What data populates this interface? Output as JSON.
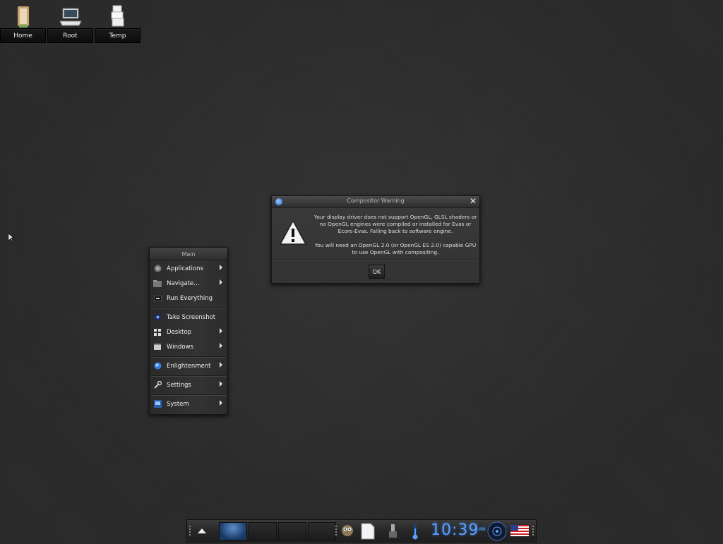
{
  "desktop": {
    "shortcuts": [
      {
        "label": "Home",
        "icon": "home-door-icon"
      },
      {
        "label": "Root",
        "icon": "computer-laptop-icon"
      },
      {
        "label": "Temp",
        "icon": "temp-folder-icon"
      }
    ]
  },
  "dialog": {
    "title": "Compositor Warning",
    "icon": "warning-triangle-icon",
    "message_1": "Your display driver does not support OpenGL, GLSL shaders or no OpenGL engines were compiled or installed for Evas or Ecore-Evas. Falling back to software engine.",
    "message_2": "You will need an OpenGL 2.0 (or OpenGL ES 2.0) capable GPU to use OpenGL with compositing.",
    "ok_label": "OK",
    "close_glyph": "✕"
  },
  "menu": {
    "title": "Main",
    "items": [
      {
        "label": "Applications",
        "icon": "applications-icon",
        "submenu": true
      },
      {
        "label": "Navigate...",
        "icon": "navigate-folder-icon",
        "submenu": true
      },
      {
        "label": "Run Everything",
        "icon": "run-everything-icon",
        "submenu": false
      },
      {
        "label": "Take Screenshot",
        "icon": "screenshot-icon",
        "submenu": false
      },
      {
        "label": "Desktop",
        "icon": "desktop-grid-icon",
        "submenu": true
      },
      {
        "label": "Windows",
        "icon": "windows-icon",
        "submenu": true
      },
      {
        "label": "Enlightenment",
        "icon": "enlightenment-logo-icon",
        "submenu": true
      },
      {
        "label": "Settings",
        "icon": "settings-wrench-icon",
        "submenu": true
      },
      {
        "label": "System",
        "icon": "system-icon",
        "submenu": true
      }
    ]
  },
  "shelf": {
    "pager_desktops": 4,
    "active_desktop": 1,
    "clock_time": "10:39",
    "clock_ampm": "AM",
    "tray_icons": [
      "gadget-owl-icon",
      "document-icon",
      "usb-plug-icon",
      "thermometer-icon",
      "clock-icon",
      "mixer-disc-icon",
      "us-flag-icon"
    ]
  },
  "colors": {
    "accent": "#5aa0ff",
    "background": "#2b2b2b"
  }
}
